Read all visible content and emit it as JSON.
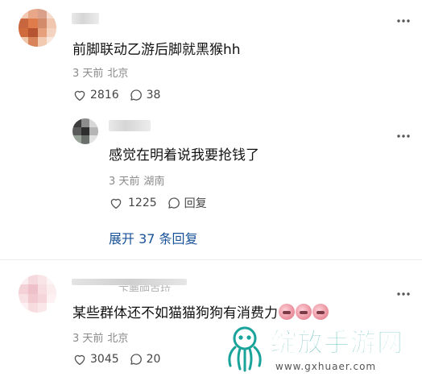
{
  "comments": [
    {
      "text": "前脚联动乙游后脚就黑猴hh",
      "time": "3 天前",
      "location": "北京",
      "likes": "2816",
      "replies": "38"
    },
    {
      "text": "感觉在明着说我要抢钱了",
      "time": "3 天前",
      "location": "湖南",
      "likes": "1225",
      "reply_label": "回复"
    },
    {
      "text": "某些群体还不如猫猫狗狗有消费力",
      "time": "3 天前",
      "location": "北京",
      "likes": "3045",
      "replies": "20",
      "name_partial": "下要吧百拉"
    }
  ],
  "expand_replies": "展开 37 条回复",
  "watermark": {
    "brand_text": "绽放手游网",
    "url": "www.gxhuaer.com",
    "color": "#1aa39a"
  },
  "icons": [
    "heart-icon",
    "comment-icon",
    "more-icon",
    "watermark-logo"
  ]
}
